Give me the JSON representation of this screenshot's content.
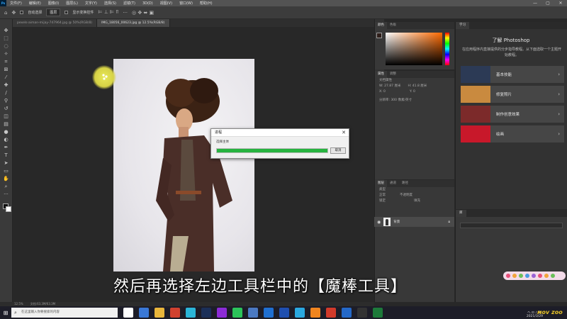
{
  "menubar": {
    "items": [
      "文件(F)",
      "编辑(E)",
      "图像(I)",
      "图层(L)",
      "文字(Y)",
      "选择(S)",
      "滤镜(T)",
      "3D(D)",
      "视图(V)",
      "窗口(W)",
      "帮助(H)"
    ],
    "window_controls": [
      "—",
      "▢",
      "✕"
    ]
  },
  "optionsbar": {
    "auto_select_label": "自动选择",
    "auto_select_value": "图层",
    "transform_label": "显示变换控件"
  },
  "doc_tabs": [
    {
      "label": "pexels-aiman-mijay-747964.jpg @ 50%(RGB/8)",
      "active": false
    },
    {
      "label": "IMG_18056_00623.jpg @ 12.5%(RGB/8)",
      "active": true
    }
  ],
  "dialog": {
    "title": "进程",
    "task": "选择主体",
    "progress": 1.0,
    "cancel_label": "取消",
    "close": "✕",
    "progress_color": "#27b33f"
  },
  "color_panel": {
    "tabs": [
      "颜色",
      "色板"
    ]
  },
  "properties_panel": {
    "tabs": [
      "属性",
      "调整"
    ],
    "doc_label": "文档属性",
    "w": "W: 27.87 厘米",
    "h": "H: 41.8 厘米",
    "x": "X: 0",
    "y": "Y: 0",
    "resolution": "分辨率: 300 像素/英寸"
  },
  "layers_panel": {
    "tabs": [
      "图层",
      "通道",
      "路径"
    ],
    "kind_label": "类型",
    "mode_label": "正常",
    "opacity_label": "不透明度",
    "lock_label": "锁定",
    "fill_label": "填充",
    "layer_name": "背景"
  },
  "learn_panel": {
    "tab": "学习",
    "title": "了解 Photoshop",
    "subtitle": "在应用程序内直接提供的分步指导教程。从下面选取一个主题开始教程。",
    "cards": [
      {
        "label": "基本技能",
        "color": "#2c3a55"
      },
      {
        "label": "修复照片",
        "color": "#c98a3f"
      },
      {
        "label": "制作创意效果",
        "color": "#7c2a2a"
      },
      {
        "label": "绘画",
        "color": "#c8182a"
      }
    ]
  },
  "libraries_panel": {
    "tab": "库"
  },
  "statusbar": {
    "zoom": "12.5%",
    "doc": "文档:63.3M/63.3M"
  },
  "subtitle": "然后再选择左边工具栏中的【魔棒工具】",
  "taskbar": {
    "start_icon": "⊞",
    "search_placeholder": "在这里输入你要搜索的内容",
    "app_colors": [
      "#ffffff",
      "#3a78d6",
      "#e9b63b",
      "#d0412f",
      "#2bb5d8",
      "#1b2f58",
      "#8c2bd6",
      "#2bc35a",
      "#4b79c2",
      "#1f6fd1",
      "#1f4fb0",
      "#2aa8e0",
      "#f0851f",
      "#d13a2a",
      "#2468c8",
      "#333333",
      "#1d7a3a"
    ],
    "tray": "へ  ⊡  ♪  中",
    "time": "2021/3/29"
  },
  "logo_text": "ᴍᴏᴠ ᴢᴏᴏ"
}
